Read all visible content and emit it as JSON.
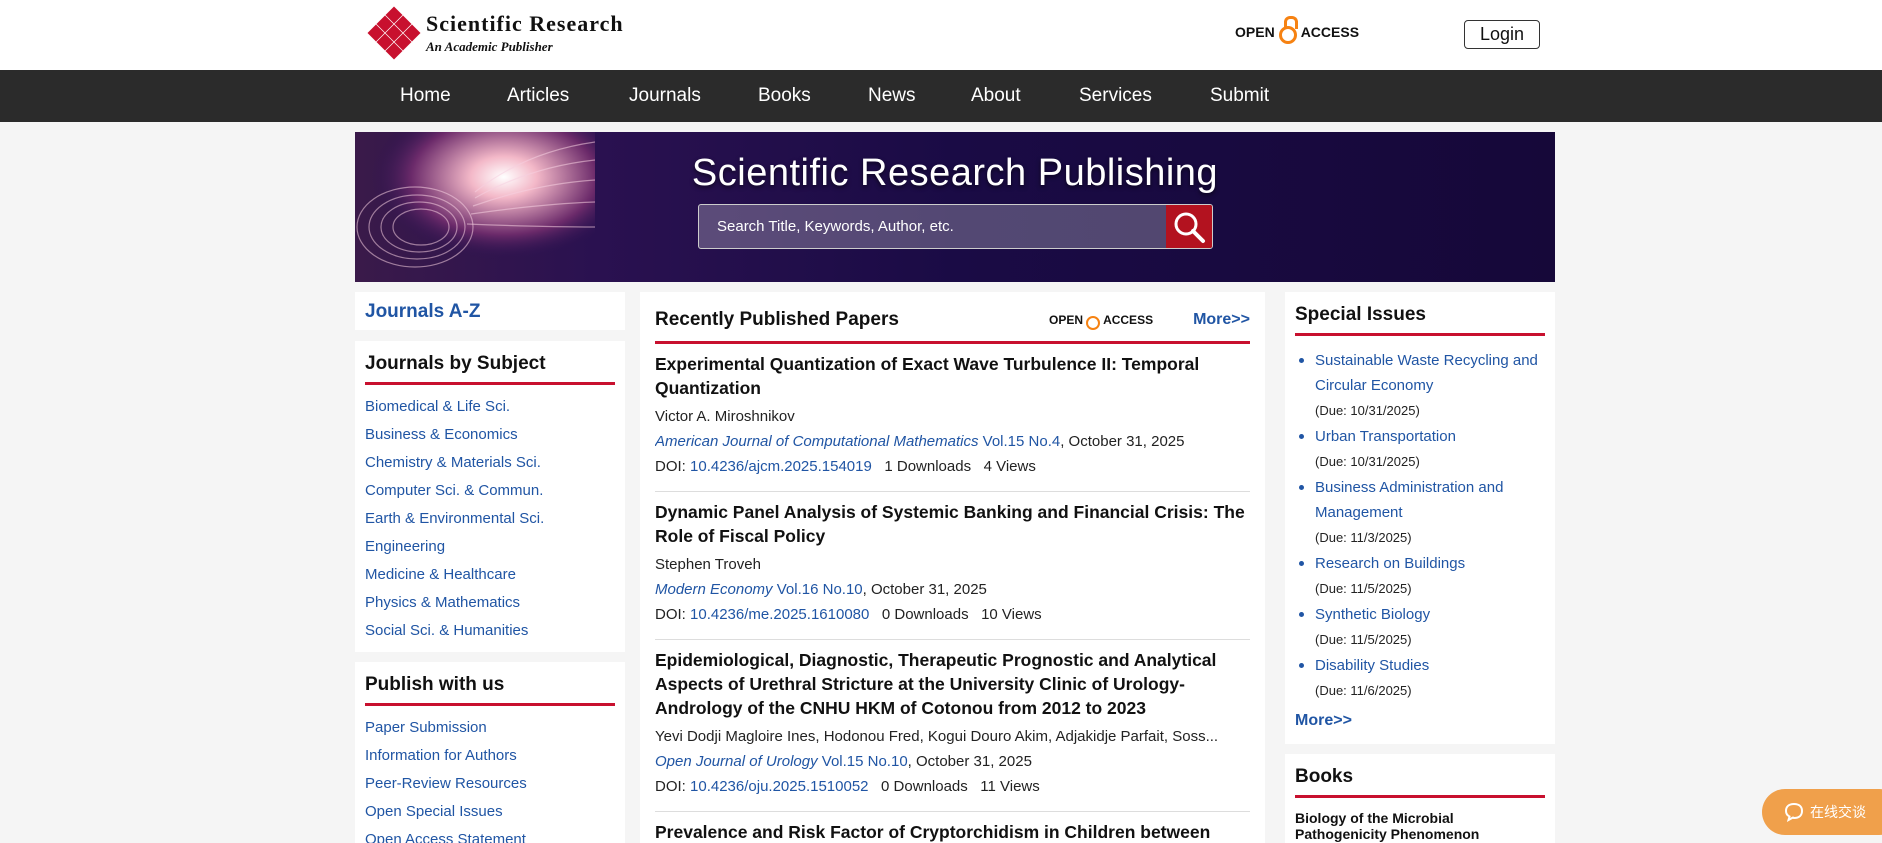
{
  "brand": {
    "name": "Scientific Research",
    "tagline": "An Academic Publisher",
    "open_access_left": "OPEN",
    "open_access_right": "ACCESS",
    "login_label": "Login"
  },
  "nav": {
    "items": [
      "Home",
      "Articles",
      "Journals",
      "Books",
      "News",
      "About",
      "Services",
      "Submit"
    ]
  },
  "banner": {
    "title": "Scientific Research Publishing",
    "search_placeholder": "Search Title, Keywords, Author, etc."
  },
  "left": {
    "journals_az": "Journals A-Z",
    "by_subject_title": "Journals by Subject",
    "subjects": [
      "Biomedical & Life Sci.",
      "Business & Economics",
      "Chemistry & Materials Sci.",
      "Computer Sci. & Commun.",
      "Earth & Environmental Sci.",
      "Engineering",
      "Medicine & Healthcare",
      "Physics & Mathematics",
      "Social Sci. & Humanities"
    ],
    "publish_title": "Publish with us",
    "publish_links": [
      "Paper Submission",
      "Information for Authors",
      "Peer-Review Resources",
      "Open Special Issues",
      "Open Access Statement"
    ]
  },
  "recent": {
    "title": "Recently Published Papers",
    "oa_left": "OPEN",
    "oa_right": "ACCESS",
    "more": "More>>",
    "doi_label": "DOI:",
    "papers": [
      {
        "title": "Experimental Quantization of Exact Wave Turbulence II: Temporal Quantization",
        "authors": "Victor A. Miroshnikov",
        "journal": "American Journal of Computational Mathematics",
        "volume": "Vol.15 No.4",
        "date": ", October 31, 2025",
        "doi": "10.4236/ajcm.2025.154019",
        "stats": "1 Downloads   4 Views"
      },
      {
        "title": "Dynamic Panel Analysis of Systemic Banking and Financial Crisis: The Role of Fiscal Policy",
        "authors": "Stephen Troveh",
        "journal": "Modern Economy",
        "volume": "Vol.16 No.10",
        "date": ", October 31, 2025",
        "doi": "10.4236/me.2025.1610080",
        "stats": "0 Downloads   10 Views"
      },
      {
        "title": "Epidemiological, Diagnostic, Therapeutic Prognostic and Analytical Aspects of Urethral Stricture at the University Clinic of Urology-Andrology of the CNHU HKM of Cotonou from 2012 to 2023",
        "authors": "Yevi Dodji Magloire Ines, Hodonou Fred, Kogui Douro Akim, Adjakidje Parfait, Soss...",
        "journal": "Open Journal of Urology",
        "volume": "Vol.15 No.10",
        "date": ", October 31, 2025",
        "doi": "10.4236/oju.2025.1510052",
        "stats": "0 Downloads   11 Views"
      },
      {
        "title": "Prevalence and Risk Factor of Cryptorchidism in Children between",
        "authors": "",
        "journal": "",
        "volume": "",
        "date": "",
        "doi": "",
        "stats": ""
      }
    ]
  },
  "special": {
    "title": "Special Issues",
    "items": [
      {
        "name": "Sustainable Waste Recycling and Circular Economy",
        "due": "(Due: 10/31/2025)"
      },
      {
        "name": "Urban Transportation",
        "due": "(Due: 10/31/2025)"
      },
      {
        "name": "Business Administration and Management",
        "due": "(Due: 11/3/2025)"
      },
      {
        "name": "Research on Buildings",
        "due": "(Due: 11/5/2025)"
      },
      {
        "name": "Synthetic Biology",
        "due": "(Due: 11/5/2025)"
      },
      {
        "name": "Disability Studies",
        "due": "(Due: 11/6/2025)"
      }
    ],
    "more": "More>>"
  },
  "books": {
    "title": "Books",
    "first_book": "Biology of the Microbial Pathogenicity Phenomenon"
  },
  "chat": {
    "label": "在线交谈"
  },
  "colors": {
    "accent_red": "#c8102e",
    "link_blue": "#2055a4",
    "nav_bg": "#2b2b2b",
    "oa_orange": "#f68212"
  }
}
